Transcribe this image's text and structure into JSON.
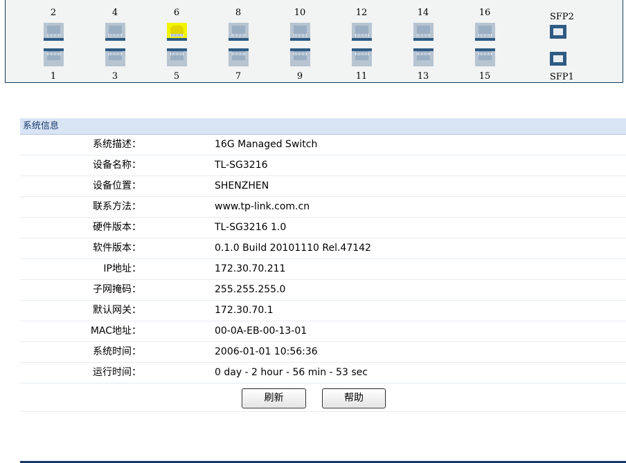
{
  "ports": {
    "top": [
      {
        "label": "2",
        "active": false
      },
      {
        "label": "4",
        "active": false
      },
      {
        "label": "6",
        "active": true
      },
      {
        "label": "8",
        "active": false
      },
      {
        "label": "10",
        "active": false
      },
      {
        "label": "12",
        "active": false
      },
      {
        "label": "14",
        "active": false
      },
      {
        "label": "16",
        "active": false
      }
    ],
    "bottom": [
      {
        "label": "1",
        "active": false
      },
      {
        "label": "3",
        "active": false
      },
      {
        "label": "5",
        "active": false
      },
      {
        "label": "7",
        "active": false
      },
      {
        "label": "9",
        "active": false
      },
      {
        "label": "11",
        "active": false
      },
      {
        "label": "13",
        "active": false
      },
      {
        "label": "15",
        "active": false
      }
    ],
    "sfp2_label": "SFP2",
    "sfp1_label": "SFP1"
  },
  "system_info": {
    "header": "系统信息",
    "rows": [
      {
        "label": "系统描述：",
        "value": "16G Managed Switch"
      },
      {
        "label": "设备名称：",
        "value": "TL-SG3216"
      },
      {
        "label": "设备位置：",
        "value": "SHENZHEN"
      },
      {
        "label": "联系方法：",
        "value": "www.tp-link.com.cn"
      },
      {
        "label": "硬件版本：",
        "value": "TL-SG3216 1.0"
      },
      {
        "label": "软件版本：",
        "value": "0.1.0 Build 20101110 Rel.47142"
      },
      {
        "label": "IP地址：",
        "value": "172.30.70.211"
      },
      {
        "label": "子网掩码：",
        "value": "255.255.255.0"
      },
      {
        "label": "默认网关：",
        "value": "172.30.70.1"
      },
      {
        "label": "MAC地址：",
        "value": "00-0A-EB-00-13-01"
      },
      {
        "label": "系统时间：",
        "value": "2006-01-01 10:56:36"
      },
      {
        "label": "运行时间：",
        "value": "0 day - 2 hour - 56 min - 53 sec"
      }
    ]
  },
  "buttons": {
    "refresh": "刷新",
    "help": "帮助"
  },
  "colors": {
    "active_port": "#f1f500",
    "header_bg": "#d9e4f5",
    "border": "#0f3b62"
  }
}
